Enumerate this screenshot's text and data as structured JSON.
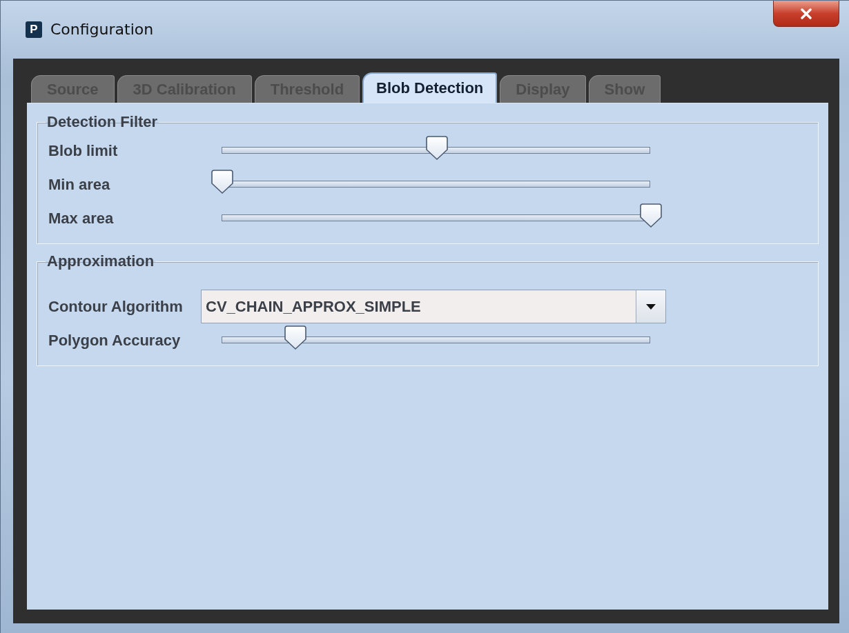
{
  "window": {
    "title": "Configuration",
    "icon_letter": "P"
  },
  "tabs": [
    {
      "label": "Source",
      "selected": false
    },
    {
      "label": "3D Calibration",
      "selected": false
    },
    {
      "label": "Threshold",
      "selected": false
    },
    {
      "label": "Blob Detection",
      "selected": true
    },
    {
      "label": "Display",
      "selected": false
    },
    {
      "label": "Show",
      "selected": false
    }
  ],
  "groups": [
    {
      "title": "Detection Filter",
      "rows": [
        {
          "kind": "slider",
          "label": "Blob limit",
          "level": 0.5
        },
        {
          "kind": "slider",
          "label": "Min area",
          "level": 0
        },
        {
          "kind": "slider",
          "label": "Max area",
          "level": 1
        }
      ]
    },
    {
      "title": "Approximation",
      "rows": [
        {
          "kind": "dropdown",
          "label": "Contour Algorithm",
          "value": "CV_CHAIN_APPROX_SIMPLE"
        },
        {
          "kind": "slider",
          "label": "Polygon Accuracy",
          "level": 0.17
        }
      ]
    }
  ]
}
